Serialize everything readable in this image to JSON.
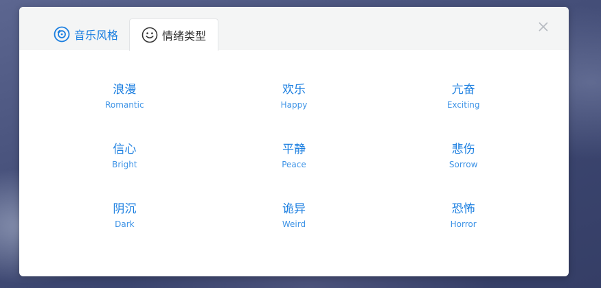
{
  "tabs": [
    {
      "label": "音乐风格",
      "icon": "disc-icon",
      "active": false
    },
    {
      "label": "情绪类型",
      "icon": "smile-icon",
      "active": true
    }
  ],
  "close_icon": "close-icon",
  "colors": {
    "accent": "#1a7ee0",
    "tab_inactive_text": "#1a7ee0",
    "tab_active_text": "#333333"
  },
  "moods": [
    [
      {
        "cn": "浪漫",
        "en": "Romantic"
      },
      {
        "cn": "欢乐",
        "en": "Happy"
      },
      {
        "cn": "亢奋",
        "en": "Exciting"
      }
    ],
    [
      {
        "cn": "信心",
        "en": "Bright"
      },
      {
        "cn": "平静",
        "en": "Peace"
      },
      {
        "cn": "悲伤",
        "en": "Sorrow"
      }
    ],
    [
      {
        "cn": "阴沉",
        "en": "Dark"
      },
      {
        "cn": "诡异",
        "en": "Weird"
      },
      {
        "cn": "恐怖",
        "en": "Horror"
      }
    ]
  ]
}
